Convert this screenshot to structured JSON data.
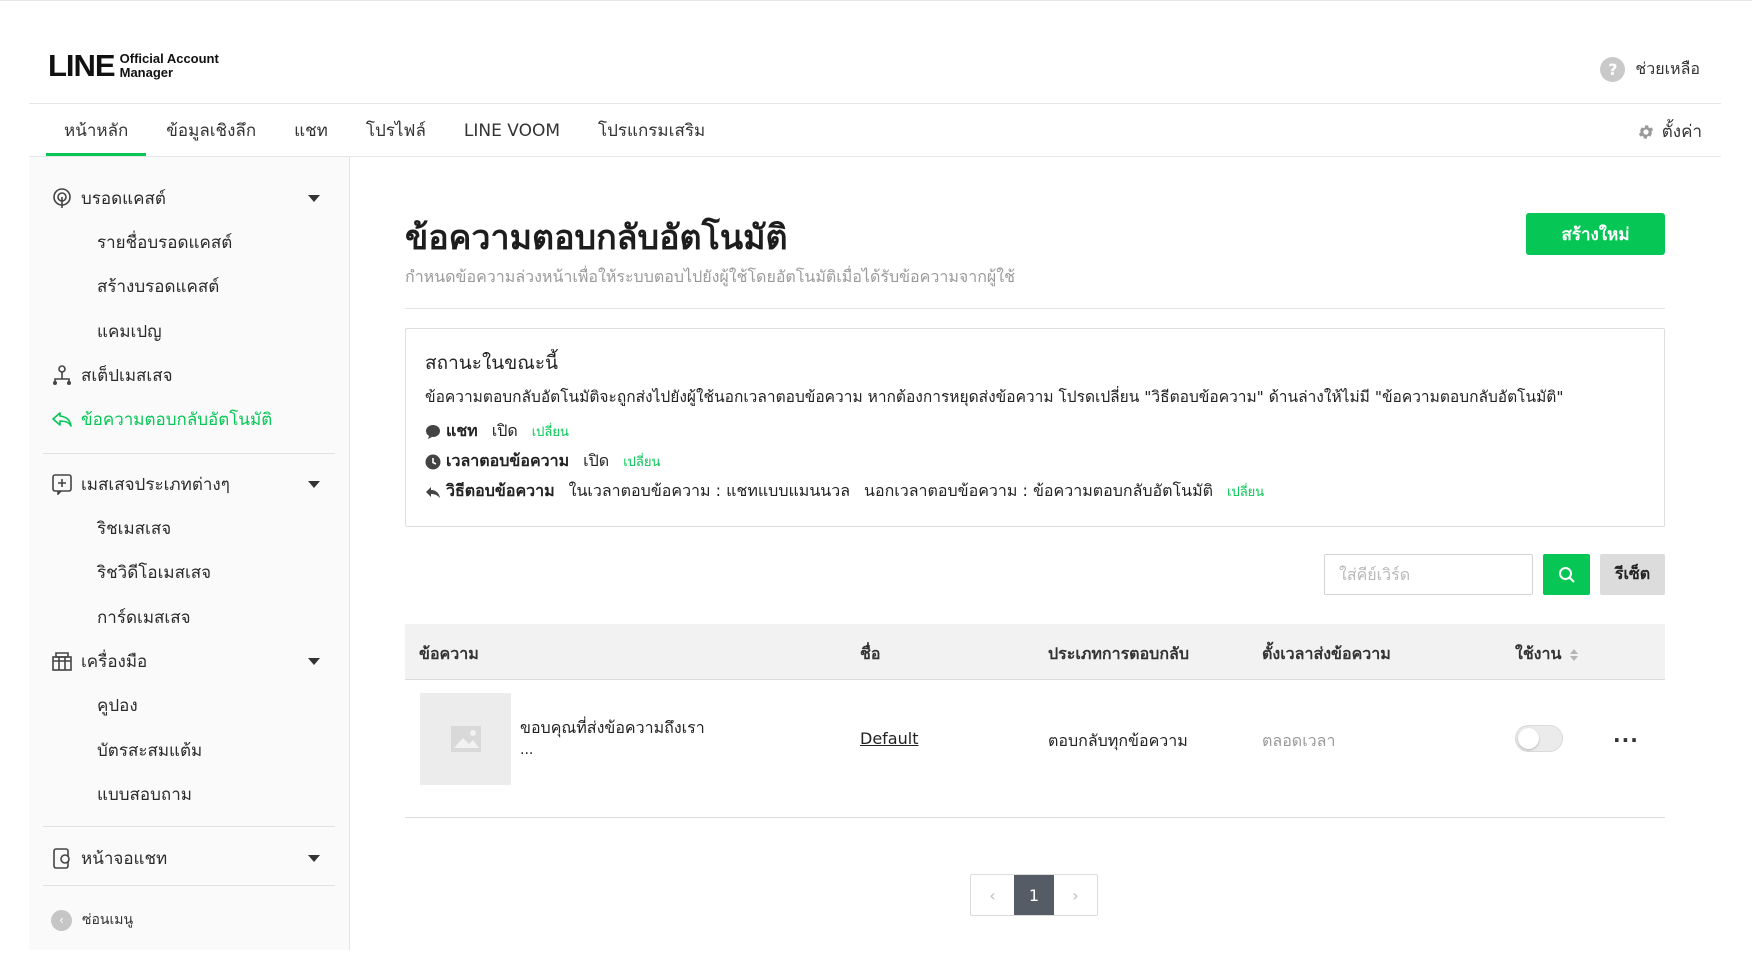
{
  "app": {
    "logo_main": "LINE",
    "logo_sub_1": "Official Account",
    "logo_sub_2": "Manager",
    "help_icon": "?",
    "help_label": "ช่วยเหลือ",
    "settings_label": "ตั้งค่า"
  },
  "nav": {
    "tabs": [
      {
        "label": "หน้าหลัก",
        "active": true
      },
      {
        "label": "ข้อมูลเชิงลึก"
      },
      {
        "label": "แชท"
      },
      {
        "label": "โปรไฟล์"
      },
      {
        "label": "LINE VOOM"
      },
      {
        "label": "โปรแกรมเสริม"
      }
    ]
  },
  "sidebar": {
    "broadcast": "บรอดแคสต์",
    "broadcast_list": "รายชื่อบรอดแคสต์",
    "broadcast_create": "สร้างบรอดแคสต์",
    "campaign": "แคมเปญ",
    "step_message": "สเต็ปเมสเสจ",
    "auto_reply": "ข้อความตอบกลับอัตโนมัติ",
    "message_types": "เมสเสจประเภทต่างๆ",
    "rich_message": "ริชเมสเสจ",
    "rich_video": "ริชวิดีโอเมสเสจ",
    "card_message": "การ์ดเมสเสจ",
    "tools": "เครื่องมือ",
    "coupon": "คูปอง",
    "reward_card": "บัตรสะสมแต้ม",
    "survey": "แบบสอบถาม",
    "chat_screen": "หน้าจอแชท",
    "collapse_icon": "‹",
    "collapse": "ซ่อนเมนู"
  },
  "main": {
    "title": "ข้อความตอบกลับอัตโนมัติ",
    "description": "กำหนดข้อความล่วงหน้าเพื่อให้ระบบตอบไปยังผู้ใช้โดยอัตโนมัติเมื่อได้รับข้อความจากผู้ใช้",
    "create_button": "สร้างใหม่",
    "status": {
      "title": "สถานะในขณะนี้",
      "description": "ข้อความตอบกลับอัตโนมัติจะถูกส่งไปยังผู้ใช้นอกเวลาตอบข้อความ หากต้องการหยุดส่งข้อความ โปรดเปลี่ยน \"วิธีตอบข้อความ\" ด้านล่างให้ไม่มี \"ข้อความตอบกลับอัตโนมัติ\"",
      "chat_label": "แชท",
      "chat_value": "เปิด",
      "hours_label": "เวลาตอบข้อความ",
      "hours_value": "เปิด",
      "method_label": "วิธีตอบข้อความ",
      "method_in_hours": "ในเวลาตอบข้อความ : แชทแบบแมนนวล",
      "method_out_hours": "นอกเวลาตอบข้อความ : ข้อความตอบกลับอัตโนมัติ",
      "change_link": "เปลี่ยน"
    },
    "search": {
      "placeholder": "ใส่คีย์เวิร์ด",
      "value": "",
      "reset_label": "รีเซ็ต"
    },
    "table": {
      "headers": [
        "ข้อความ",
        "ชื่อ",
        "ประเภทการตอบกลับ",
        "ตั้งเวลาส่งข้อความ",
        "ใช้งาน"
      ],
      "rows": [
        {
          "message_line1": "ขอบคุณที่ส่งข้อความถึงเรา",
          "message_line2": "...",
          "name": "Default",
          "reply_type": "ตอบกลับทุกข้อความ",
          "schedule": "ตลอดเวลา",
          "enabled": false,
          "more": "···"
        }
      ]
    },
    "pagination": {
      "prev": "‹",
      "current": "1",
      "next": "›"
    }
  },
  "colors": {
    "accent": "#06c755",
    "pager_active": "#555c66"
  }
}
